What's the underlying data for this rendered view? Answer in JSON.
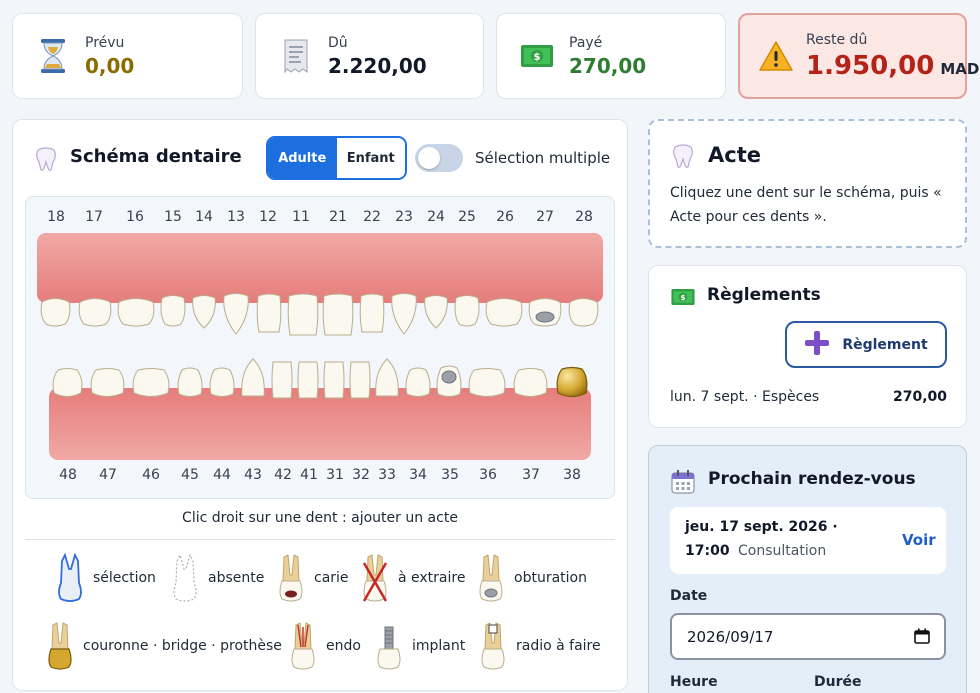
{
  "summary": {
    "prevu": {
      "label": "Prévu",
      "value": "0,00",
      "icon": "hourglass-icon",
      "color": "#8a6d00"
    },
    "du": {
      "label": "Dû",
      "value": "2.220,00",
      "icon": "receipt-icon",
      "color": "#111827"
    },
    "paye": {
      "label": "Payé",
      "value": "270,00",
      "icon": "money-icon",
      "color": "#2e7d32"
    },
    "reste": {
      "label": "Reste dû",
      "value": "1.950,00",
      "currency": "MAD",
      "icon": "warning-icon",
      "color": "#b42318"
    }
  },
  "schema": {
    "title": "Schéma dentaire",
    "mode_adult": "Adulte",
    "mode_child": "Enfant",
    "multi_select_label": "Sélection multiple",
    "upper_teeth": [
      "18",
      "17",
      "16",
      "15",
      "14",
      "13",
      "12",
      "11",
      "21",
      "22",
      "23",
      "24",
      "25",
      "26",
      "27",
      "28"
    ],
    "lower_teeth": [
      "48",
      "47",
      "46",
      "45",
      "44",
      "43",
      "42",
      "41",
      "31",
      "32",
      "33",
      "34",
      "35",
      "36",
      "37",
      "38"
    ],
    "hint": "Clic droit sur une dent : ajouter un acte",
    "legend": {
      "selection": "sélection",
      "absente": "absente",
      "carie": "carie",
      "extraire": "à extraire",
      "obturation": "obturation",
      "couronne": "couronne · bridge · prothèse",
      "endo": "endo",
      "implant": "implant",
      "radio": "radio à faire"
    }
  },
  "acte": {
    "title": "Acte",
    "text": "Cliquez une dent sur le schéma, puis « Acte pour ces dents »."
  },
  "reglements": {
    "title": "Règlements",
    "button": "Règlement",
    "entries": [
      {
        "date_method": "lun. 7 sept. · Espèces",
        "amount": "270,00"
      }
    ]
  },
  "rdv": {
    "title": "Prochain rendez-vous",
    "date_line": "jeu. 17 sept. 2026 ·",
    "time": "17:00",
    "type": "Consultation",
    "view": "Voir",
    "date_label": "Date",
    "date_value": "2026/09/17",
    "heure_label": "Heure",
    "duree_label": "Durée"
  }
}
